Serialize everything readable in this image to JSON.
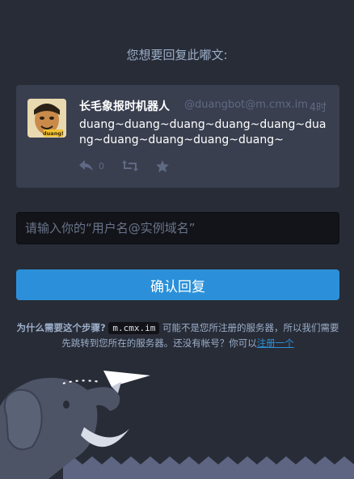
{
  "page": {
    "heading": "您想要回复此嘟文:"
  },
  "status": {
    "display_name": "长毛象报时机器人",
    "acct": "@duangbot@m.cmx.im",
    "time": "4时",
    "content": "duang~duang~duang~duang~duang~duang~duang~duang~duang~duang~",
    "reply_count": "0",
    "avatar_text": "duang!"
  },
  "form": {
    "placeholder": "请输入你的“用户名@实例域名”",
    "submit_label": "确认回复"
  },
  "hint": {
    "question": "为什么需要这个步骤?",
    "domain": "m.cmx.im",
    "text": "可能不是您所注册的服务器，所以我们需要先跳转到您所在的服务器。还没有帐号？你可以",
    "link": "注册一个"
  },
  "colors": {
    "background": "#282c37",
    "card": "#393f4f",
    "accent": "#2b90d9",
    "muted": "#606984"
  },
  "icons": {
    "reply": "reply-icon",
    "boost": "boost-icon",
    "favourite": "star-icon"
  }
}
